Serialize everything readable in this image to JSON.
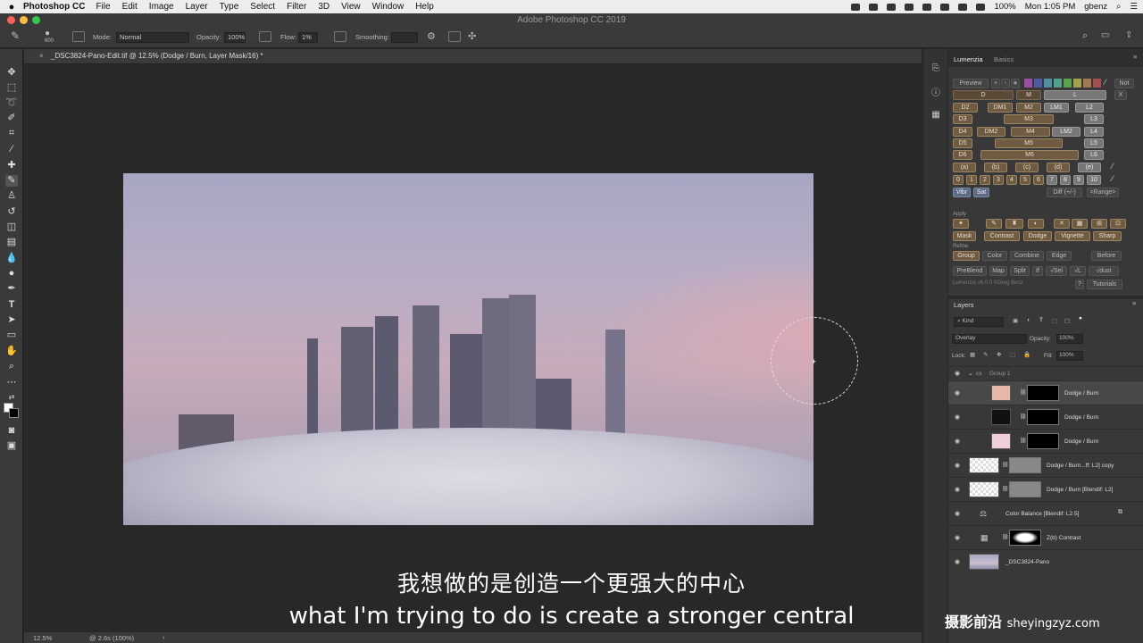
{
  "menubar": {
    "app_name": "Photoshop CC",
    "items": [
      "File",
      "Edit",
      "Image",
      "Layer",
      "Type",
      "Select",
      "Filter",
      "3D",
      "View",
      "Window",
      "Help"
    ],
    "battery": "100%",
    "clock": "Mon 1:05 PM",
    "user": "gbenz"
  },
  "window": {
    "title": "Adobe Photoshop CC 2019"
  },
  "options": {
    "brush_size": "600",
    "mode_label": "Mode:",
    "mode_value": "Normal",
    "opacity_label": "Opacity:",
    "opacity_value": "100%",
    "flow_label": "Flow:",
    "flow_value": "1%",
    "smoothing_label": "Smoothing:"
  },
  "document": {
    "tab_title": "_DSC3824-Pano-Edit.tif @ 12.5% (Dodge / Burn, Layer Mask/16) *",
    "zoom": "12.5%",
    "status": "@ 2.6s (100%)"
  },
  "subtitles": {
    "chinese": "我想做的是创造一个更强大的中心",
    "english": "what I'm trying to do is create a stronger central"
  },
  "lumenzia": {
    "tab_active": "Lumenzia",
    "tab_other": "Basics",
    "preview": "Preview",
    "not": "Not",
    "x": "X",
    "colors": [
      "#9a4fa3",
      "#4f5aa3",
      "#4f8fa3",
      "#4fa38a",
      "#5aa34f",
      "#a3a34f",
      "#a37a4f",
      "#a34f4f"
    ],
    "rows": {
      "r1": [
        "D",
        "M",
        "L"
      ],
      "r2": [
        "D2",
        "DM1",
        "M2",
        "LM1",
        "L2"
      ],
      "r3": [
        "D3",
        "M3",
        "L3"
      ],
      "r4": [
        "D4",
        "DM2",
        "M4",
        "LM2",
        "L4"
      ],
      "r5": [
        "D5",
        "M5",
        "L5"
      ],
      "r6": [
        "D6",
        "M6",
        "L6"
      ],
      "r7": [
        "(a)",
        "(b)",
        "(c)",
        "(d)",
        "(e)"
      ],
      "r8": [
        "0",
        "1",
        "2",
        "3",
        "4",
        "5",
        "6",
        "7",
        "8",
        "9",
        "10"
      ],
      "r9": [
        "Vibr",
        "Sat",
        "Diff (+/-)",
        "<Range>"
      ]
    },
    "apply_label": "Apply",
    "apply_row": [
      "Sel",
      "Mask",
      "Contrast",
      "Dodge",
      "Vignette",
      "Sharp"
    ],
    "refine_label": "Refine",
    "refine_row": [
      "Group",
      "Color",
      "Combine",
      "Edge",
      "Before"
    ],
    "bottom_row": [
      "PreBlend",
      "Map",
      "Split",
      "If",
      "√Sel",
      "√L",
      "√dust"
    ],
    "version": "Lumenzia v8.0.0 ©Greg Benz",
    "q": "?",
    "tutorials": "Tutorials"
  },
  "layers": {
    "title": "Layers",
    "kind": "Kind",
    "blend_mode": "Overlay",
    "opacity_label": "Opacity:",
    "opacity": "100%",
    "lock_label": "Lock:",
    "fill_label": "Fill:",
    "fill": "100%",
    "items": [
      {
        "name": "Group 1"
      },
      {
        "name": "Dodge / Burn"
      },
      {
        "name": "Dodge / Burn"
      },
      {
        "name": "Dodge / Burn"
      },
      {
        "name": "Dodge / Burn...ff: L2] copy"
      },
      {
        "name": "Dodge / Burn [Blendif: L2]"
      },
      {
        "name": "Color Balance [Blendif: L2.5]"
      },
      {
        "name": "Z(b) Contrast"
      },
      {
        "name": "_DSC3824-Pano"
      }
    ]
  },
  "watermark": {
    "cn": "摄影前沿",
    "url": "sheyingzyz.com"
  }
}
